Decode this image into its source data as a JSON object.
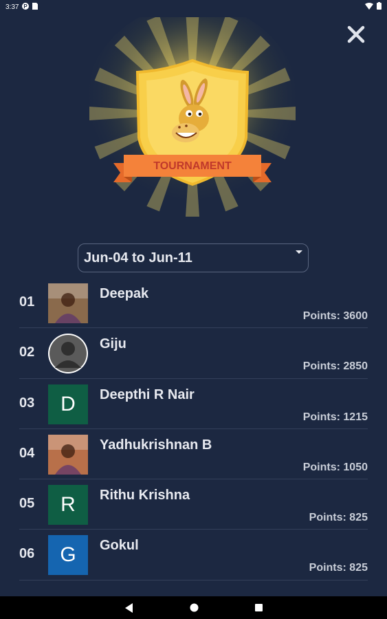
{
  "status_bar": {
    "time": "3:37",
    "icons": [
      "play-icon",
      "sim-card-icon",
      "wifi-icon",
      "battery-icon"
    ]
  },
  "close_button": {
    "icon": "close-icon"
  },
  "banner": {
    "label": "TOURNAMENT",
    "colors": {
      "shield": "#f8cf4a",
      "ribbon": "#f4823a",
      "ribbon_text": "#c0392b",
      "rays": "#ffe46a"
    }
  },
  "date_range": {
    "selected": "Jun-04 to Jun-11"
  },
  "leaderboard": {
    "entries": [
      {
        "rank": "01",
        "name": "Deepak",
        "points": "Points: 3600",
        "avatar": {
          "type": "photo",
          "letter": "",
          "color": "#8a6a4c"
        }
      },
      {
        "rank": "02",
        "name": "Giju",
        "points": "Points: 2850",
        "avatar": {
          "type": "default",
          "letter": "",
          "color": "#5a5a5a"
        }
      },
      {
        "rank": "03",
        "name": "Deepthi R Nair",
        "points": "Points: 1215",
        "avatar": {
          "type": "letter",
          "letter": "D",
          "color": "#0f5e44"
        }
      },
      {
        "rank": "04",
        "name": "Yadhukrishnan B",
        "points": "Points: 1050",
        "avatar": {
          "type": "photo",
          "letter": "",
          "color": "#b8704a"
        }
      },
      {
        "rank": "05",
        "name": "Rithu Krishna",
        "points": "Points: 825",
        "avatar": {
          "type": "letter",
          "letter": "R",
          "color": "#0f5e44"
        }
      },
      {
        "rank": "06",
        "name": "Gokul",
        "points": "Points: 825",
        "avatar": {
          "type": "letter",
          "letter": "G",
          "color": "#1565b0"
        }
      }
    ]
  },
  "nav_bar": {
    "back_icon": "back-triangle-icon",
    "home_icon": "home-circle-icon",
    "recents_icon": "recents-square-icon"
  }
}
